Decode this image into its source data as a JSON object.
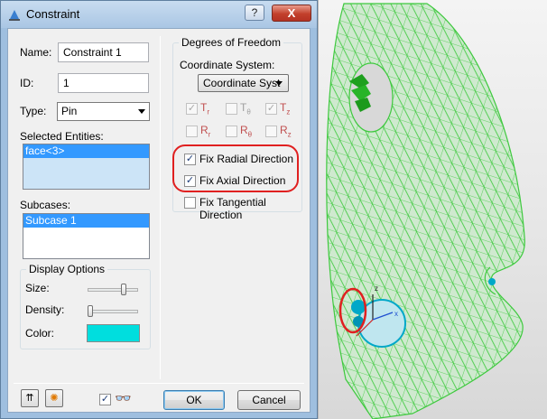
{
  "window": {
    "title": "Constraint",
    "help_button": "?",
    "close_button": "X"
  },
  "left": {
    "name_label": "Name:",
    "name_value": "Constraint 1",
    "id_label": "ID:",
    "id_value": "1",
    "type_label": "Type:",
    "type_value": "Pin",
    "selected_entities_label": "Selected Entities:",
    "selected_entities": [
      "face<3>"
    ],
    "subcases_label": "Subcases:",
    "subcases": [
      "Subcase 1"
    ],
    "display_options": {
      "title": "Display Options",
      "size_label": "Size:",
      "density_label": "Density:",
      "color_label": "Color:",
      "color_value": "#00DEDE"
    }
  },
  "right": {
    "dof_title": "Degrees of Freedom",
    "coord_system_label": "Coordinate System:",
    "coord_system_value": "Coordinate Syst",
    "dof_items": [
      {
        "main": "T",
        "sub": "r",
        "checked": true
      },
      {
        "main": "T",
        "sub": "θ",
        "checked": false
      },
      {
        "main": "T",
        "sub": "z",
        "checked": true
      },
      {
        "main": "R",
        "sub": "r",
        "checked": false
      },
      {
        "main": "R",
        "sub": "θ",
        "checked": false
      },
      {
        "main": "R",
        "sub": "z",
        "checked": false
      }
    ],
    "fix_radial_label": "Fix Radial Direction",
    "fix_radial_checked": true,
    "fix_axial_label": "Fix Axial Direction",
    "fix_axial_checked": true,
    "fix_tangential_label": "Fix Tangential Direction",
    "fix_tangential_checked": false
  },
  "bottom": {
    "ok_label": "OK",
    "cancel_label": "Cancel",
    "show_glasses_checked": true
  },
  "viewport": {
    "mesh_color": "#3ec93e",
    "constraint_color": "#00a8c8",
    "highlight_color": "#e02020",
    "icons": [
      "collapse-icon",
      "star-icon",
      "glasses-icon"
    ]
  }
}
